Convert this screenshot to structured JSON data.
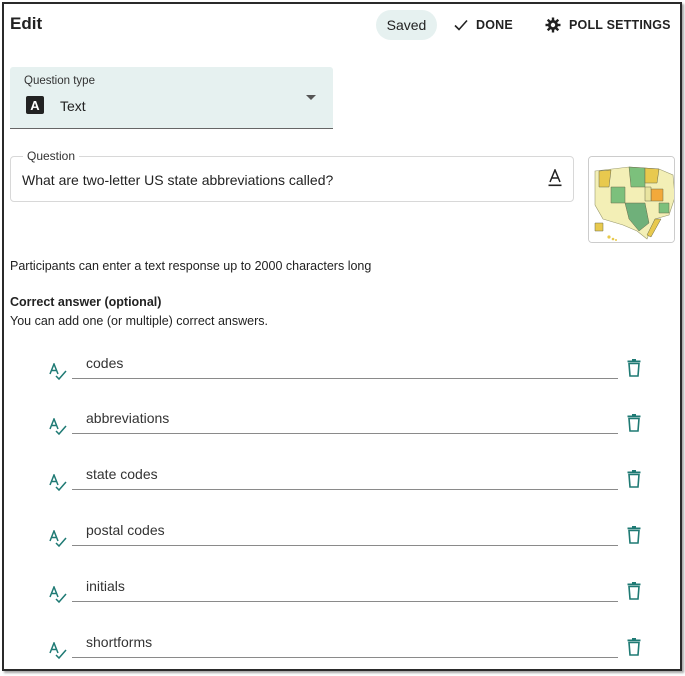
{
  "header": {
    "title": "Edit",
    "saved_label": "Saved",
    "done_label": "DONE",
    "settings_label": "POLL SETTINGS"
  },
  "question_type": {
    "label": "Question type",
    "value": "Text",
    "icon_letter": "A"
  },
  "question": {
    "legend": "Question",
    "text": "What are two-letter US state abbreviations called?"
  },
  "info": {
    "limit_text": "Participants can enter a text response up to 2000 characters long",
    "correct_title": "Correct answer (optional)",
    "correct_subtitle": "You can add one (or multiple) correct answers."
  },
  "answers": [
    {
      "text": "codes"
    },
    {
      "text": "abbreviations"
    },
    {
      "text": "state codes"
    },
    {
      "text": "postal codes"
    },
    {
      "text": "initials"
    },
    {
      "text": "shortforms"
    }
  ],
  "icons": {
    "done": "check-icon",
    "settings": "gear-icon",
    "format": "text-format-icon",
    "spellcheck": "spellcheck-icon",
    "delete": "trash-icon",
    "thumbnail": "us-map-image"
  },
  "colors": {
    "accent_teal": "#1f7a74",
    "field_bg": "#e6f1f0",
    "saved_bg": "#e6f1f0"
  }
}
